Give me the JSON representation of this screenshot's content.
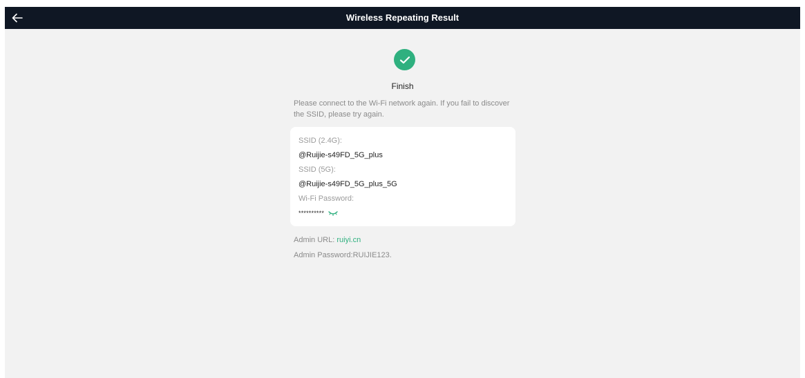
{
  "header": {
    "title": "Wireless Repeating Result",
    "back_icon": "arrow-left-icon"
  },
  "status": {
    "icon": "check-circle-icon",
    "color": "#2fb07f",
    "title": "Finish",
    "message": "Please connect to the Wi-Fi network again. If you fail to discover the SSID, please try again."
  },
  "wifi_card": {
    "ssid_24_label": "SSID (2.4G):",
    "ssid_24_value": "@Ruijie-s49FD_5G_plus",
    "ssid_5_label": "SSID (5G):",
    "ssid_5_value": "@Ruijie-s49FD_5G_plus_5G",
    "password_label": "Wi-Fi Password:",
    "password_value": "**********",
    "password_toggle_icon": "eye-closed-icon"
  },
  "admin": {
    "url_label": "Admin URL: ",
    "url_value": "ruiyi.cn",
    "password_text": "Admin Password:RUIJIE123."
  }
}
